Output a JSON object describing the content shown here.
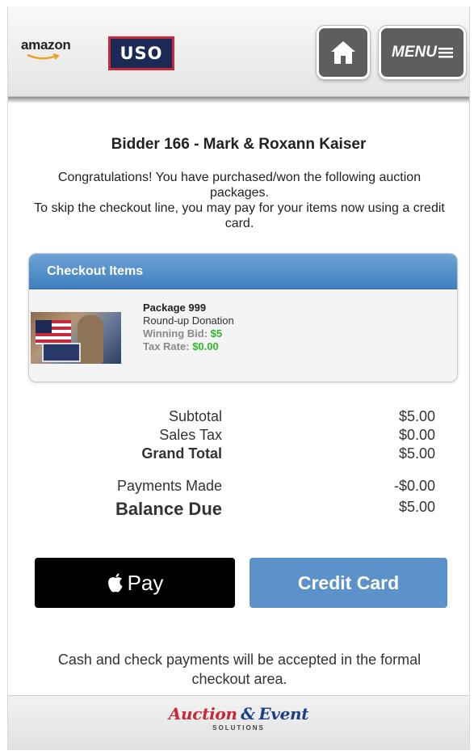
{
  "header": {
    "amazon_logo_text": "amazon",
    "uso_logo_text": "USO",
    "menu_label": "MENU"
  },
  "bidder_title": "Bidder 166 - Mark & Roxann Kaiser",
  "intro_line1": "Congratulations! You have purchased/won the following auction packages.",
  "intro_line2": "To skip the checkout line, you may pay for your items now using a credit card.",
  "checkout": {
    "title": "Checkout Items",
    "items": [
      {
        "package": "Package 999",
        "description": "Round-up Donation",
        "winning_bid_label": "Winning Bid:",
        "winning_bid_value": "$5",
        "tax_rate_label": "Tax Rate:",
        "tax_rate_value": "$0.00"
      }
    ]
  },
  "totals": {
    "subtotal_label": "Subtotal",
    "subtotal_value": "$5.00",
    "sales_tax_label": "Sales Tax",
    "sales_tax_value": "$0.00",
    "grand_total_label": "Grand Total",
    "grand_total_value": "$5.00",
    "payments_made_label": "Payments Made",
    "payments_made_value": "-$0.00",
    "balance_due_label": "Balance Due",
    "balance_due_value": "$5.00"
  },
  "buttons": {
    "apple_pay_label": "Pay",
    "credit_card_label": "Credit Card"
  },
  "cash_note": "Cash and check payments will be accepted in the formal checkout area.",
  "footer": {
    "brand_part1": "Auction",
    "brand_amp": "&",
    "brand_part2": "Event",
    "brand_sub": "SOLUTIONS"
  },
  "colors": {
    "panel_header": "#4a88c7",
    "credit_button": "#5b92c9",
    "apple_button": "#000000",
    "value_green": "#2eb82e",
    "uso_red": "#c8283c",
    "uso_navy": "#1b2a55"
  },
  "icons": [
    "home-icon",
    "menu-hamburger-icon",
    "apple-icon"
  ]
}
